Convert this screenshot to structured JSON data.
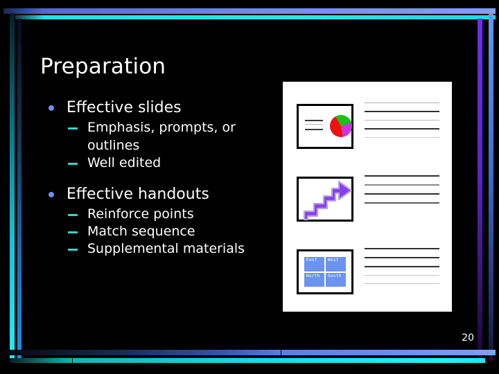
{
  "slide": {
    "title": "Preparation",
    "page_number": "20",
    "background_color": "#000000",
    "text_color": "#ffffff",
    "accent_bullet_color": "#6f8ff2",
    "accent_dash_color": "#36d6c6",
    "frame_colors": {
      "top_blue": "#6f8ff2",
      "top_cyan": "#1ee9f2",
      "left_cyan": "#1ef0f8",
      "left_blue": "#1e90e0",
      "right_purple": "#6a2ff0",
      "right_blue": "#5e9bf5",
      "bottom_blue": "#7fa0ff",
      "bottom_cyan": "#22f0fa"
    }
  },
  "content": {
    "groups": [
      {
        "heading": "Effective slides",
        "items": [
          "Emphasis, prompts, or outlines",
          "Well edited"
        ]
      },
      {
        "heading": "Effective handouts",
        "items": [
          "Reinforce points",
          "Match sequence",
          "Supplemental materials"
        ]
      }
    ]
  },
  "handout_graphic": {
    "description": "white handout page preview with three slide thumbnails and ruled note lines",
    "thumbnails": [
      {
        "name": "pie-chart-thumbnail",
        "kind": "pie",
        "slices": [
          "#19c219",
          "#cc33e0",
          "#ee1111"
        ]
      },
      {
        "name": "staircase-arrow-thumbnail",
        "kind": "arrow",
        "color": "#8a3ff0"
      },
      {
        "name": "table-thumbnail",
        "kind": "table",
        "cell_color": "#6b93ef"
      }
    ],
    "table_cells": [
      "East",
      "West",
      "North",
      "South"
    ],
    "note_line_groups": [
      {
        "lines": [
          "#b0b0b0",
          "#2e2e2e",
          "#b8b8b8",
          "#2e2e2e",
          "#cccccc"
        ]
      },
      {
        "lines": [
          "#2e2e2e",
          "#8a8a8a",
          "#2e2e2e",
          "#5a5a5a"
        ]
      },
      {
        "lines": [
          "#2e2e2e",
          "#2e2e2e",
          "#2e2e2e",
          "#c0c0c0",
          "#bcbcbc"
        ]
      }
    ]
  }
}
